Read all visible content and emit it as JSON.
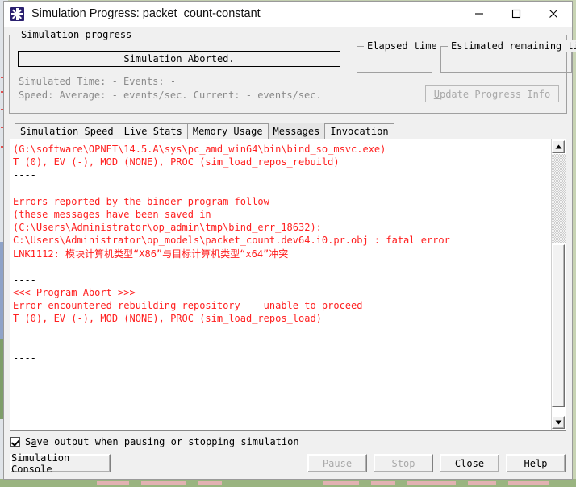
{
  "window": {
    "title": "Simulation Progress: packet_count-constant",
    "icon": "opnet-star-icon",
    "minimize": "minimize-icon",
    "maximize": "maximize-icon",
    "close": "close-icon"
  },
  "progress_group": {
    "title": "Simulation progress",
    "progress_bar_text": "Simulation Aborted.",
    "elapsed": {
      "title": "Elapsed time",
      "value": "-"
    },
    "remaining": {
      "title": "Estimated remaining time",
      "value": "-"
    },
    "stat_line_1": "Simulated Time: - Events: -",
    "stat_line_2": "Speed: Average: - events/sec. Current: - events/sec.",
    "update_button": {
      "mnemonic": "U",
      "rest": "pdate Progress Info",
      "enabled": false
    }
  },
  "tabs": [
    {
      "label": "Simulation Speed",
      "selected": false
    },
    {
      "label": "Live Stats",
      "selected": false
    },
    {
      "label": "Memory Usage",
      "selected": false
    },
    {
      "label": "Messages",
      "selected": true
    },
    {
      "label": "Invocation",
      "selected": false
    }
  ],
  "console": {
    "lines": [
      {
        "text": "(G:\\software\\OPNET\\14.5.A\\sys\\pc_amd_win64\\bin\\bind_so_msvc.exe)",
        "color": "red"
      },
      {
        "text": "T (0), EV (-), MOD (NONE), PROC (sim_load_repos_rebuild)",
        "color": "red"
      },
      {
        "text": "----",
        "color": "black"
      },
      {
        "text": "",
        "color": "black"
      },
      {
        "text": "Errors reported by the binder program follow",
        "color": "red"
      },
      {
        "text": "(these messages have been saved in",
        "color": "red"
      },
      {
        "text": "(C:\\Users\\Administrator\\op_admin\\tmp\\bind_err_18632):",
        "color": "red"
      },
      {
        "text": "C:\\Users\\Administrator\\op_models\\packet_count.dev64.i0.pr.obj : fatal error",
        "color": "red"
      },
      {
        "text": "LNK1112: 模块计算机类型“X86”与目标计算机类型“x64”冲突",
        "color": "red"
      },
      {
        "text": "",
        "color": "black"
      },
      {
        "text": "----",
        "color": "black"
      },
      {
        "text": "<<< Program Abort >>>",
        "color": "red"
      },
      {
        "text": "Error encountered rebuilding repository -- unable to proceed",
        "color": "red"
      },
      {
        "text": "T (0), EV (-), MOD (NONE), PROC (sim_load_repos_load)",
        "color": "red"
      },
      {
        "text": "",
        "color": "black"
      },
      {
        "text": "",
        "color": "black"
      },
      {
        "text": "----",
        "color": "black"
      }
    ],
    "scrollbar": {
      "up_arrow": "scroll-up-icon",
      "down_arrow": "scroll-down-icon"
    }
  },
  "bottom": {
    "save_checkbox": {
      "checked": true,
      "mnemonic": "S",
      "pre": "",
      "rest": "ave output when pausing or stopping simulation",
      "label_a": "S",
      "label_b": "a",
      "label_c": "ve output when pausing or stopping simulation"
    },
    "buttons": {
      "sim_console": {
        "label": "Simulation Console",
        "enabled": true
      },
      "pause": {
        "mnemonic": "P",
        "rest": "ause",
        "enabled": false
      },
      "stop": {
        "mnemonic": "S",
        "rest": "top",
        "enabled": false
      },
      "close": {
        "mnemonic": "C",
        "rest": "lose",
        "enabled": true
      },
      "help": {
        "mnemonic": "H",
        "rest": "elp",
        "enabled": true
      }
    }
  }
}
